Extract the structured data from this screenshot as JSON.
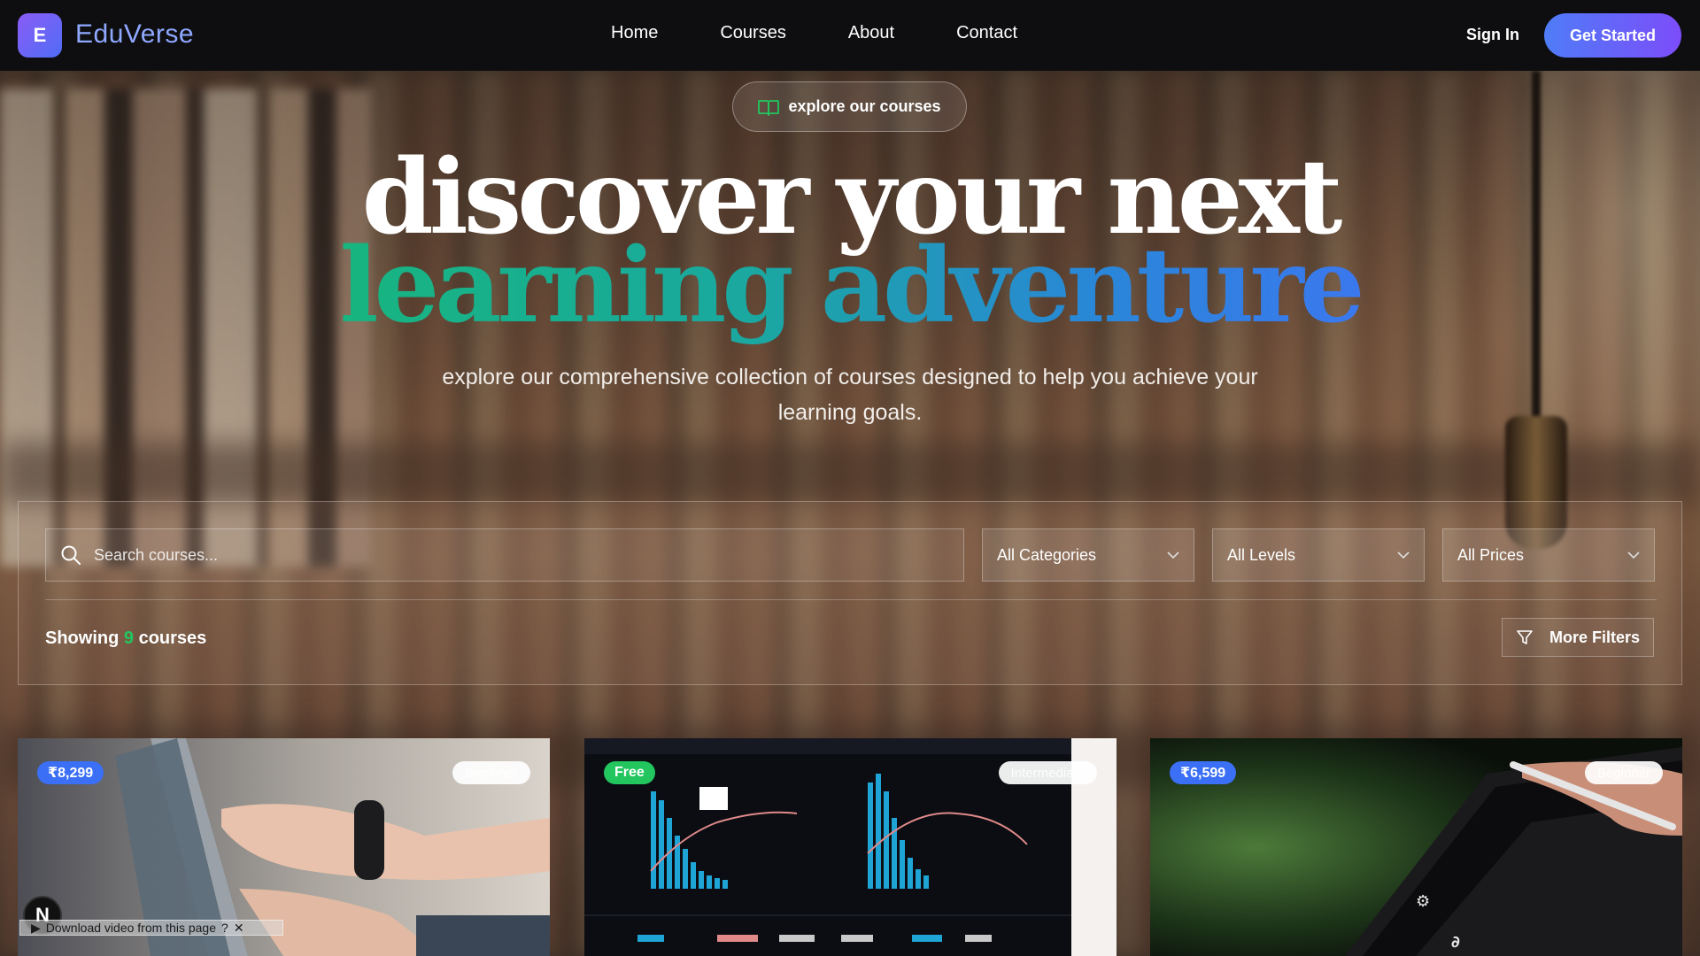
{
  "brand": {
    "logo_letter": "E",
    "name": "EduVerse"
  },
  "nav": {
    "links": [
      "Home",
      "Courses",
      "About",
      "Contact"
    ],
    "sign_in": "Sign In",
    "cta": "Get Started"
  },
  "hero": {
    "pill": "explore our courses",
    "title_line1": "discover your next",
    "title_line2": "learning adventure",
    "subtitle": "explore our comprehensive collection of courses designed to help you achieve your learning goals."
  },
  "filters": {
    "search_placeholder": "Search courses...",
    "category": "All Categories",
    "level": "All Levels",
    "price": "All Prices",
    "showing_prefix": "Showing",
    "showing_count": "9",
    "showing_suffix": "courses",
    "more_filters": "More Filters"
  },
  "courses": [
    {
      "price": "₹8,299",
      "price_color": "#3b6ff5",
      "level": "Beginner"
    },
    {
      "price": "Free",
      "price_color": "#22c55e",
      "level": "Intermediate"
    },
    {
      "price": "₹6,599",
      "price_color": "#3b6ff5",
      "level": "Beginner"
    }
  ],
  "overlay": {
    "download_text": "Download video from this page",
    "n_button": "N"
  }
}
